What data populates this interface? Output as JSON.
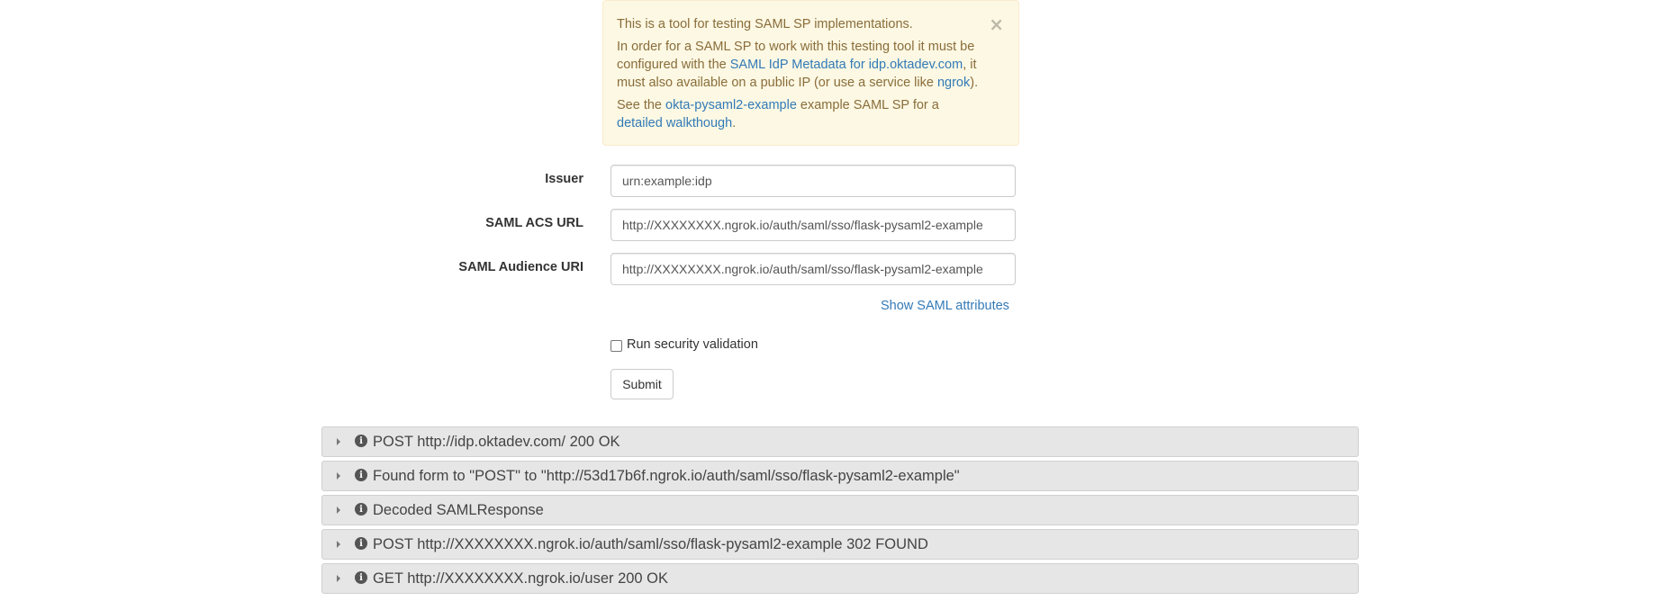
{
  "alert": {
    "line1": "This is a tool for testing SAML SP implementations.",
    "p2_text1": "In order for a SAML SP to work with this testing tool it must be configured with the ",
    "p2_link1": "SAML IdP Metadata for idp.oktadev.com",
    "p2_text2": ", it must also available on a public IP (or use a service like ",
    "p2_link2": "ngrok",
    "p2_text3": ").",
    "p3_text1": "See the ",
    "p3_link1": "okta-pysaml2-example",
    "p3_text2": " example SAML SP for a ",
    "p3_link2": "detailed walkthough",
    "p3_text3": ".",
    "close": "×"
  },
  "form": {
    "issuer_label": "Issuer",
    "issuer_value": "urn:example:idp",
    "acs_label": "SAML ACS URL",
    "acs_value": "http://XXXXXXXX.ngrok.io/auth/saml/sso/flask-pysaml2-example",
    "audience_label": "SAML Audience URI",
    "audience_value": "http://XXXXXXXX.ngrok.io/auth/saml/sso/flask-pysaml2-example",
    "show_attrs": "Show SAML attributes",
    "checkbox_label": "Run security validation",
    "checkbox_checked": false,
    "submit": "Submit"
  },
  "logs": [
    {
      "text": "POST http://idp.oktadev.com/ 200 OK"
    },
    {
      "text": "Found form to \"POST\" to \"http://53d17b6f.ngrok.io/auth/saml/sso/flask-pysaml2-example\""
    },
    {
      "text": "Decoded SAMLResponse"
    },
    {
      "text": "POST http://XXXXXXXX.ngrok.io/auth/saml/sso/flask-pysaml2-example 302 FOUND"
    },
    {
      "text": "GET http://XXXXXXXX.ngrok.io/user 200 OK"
    }
  ],
  "icons": {
    "log_caret": "caret-right-icon",
    "log_info": "info-circle-icon",
    "info_glyph": "i"
  }
}
